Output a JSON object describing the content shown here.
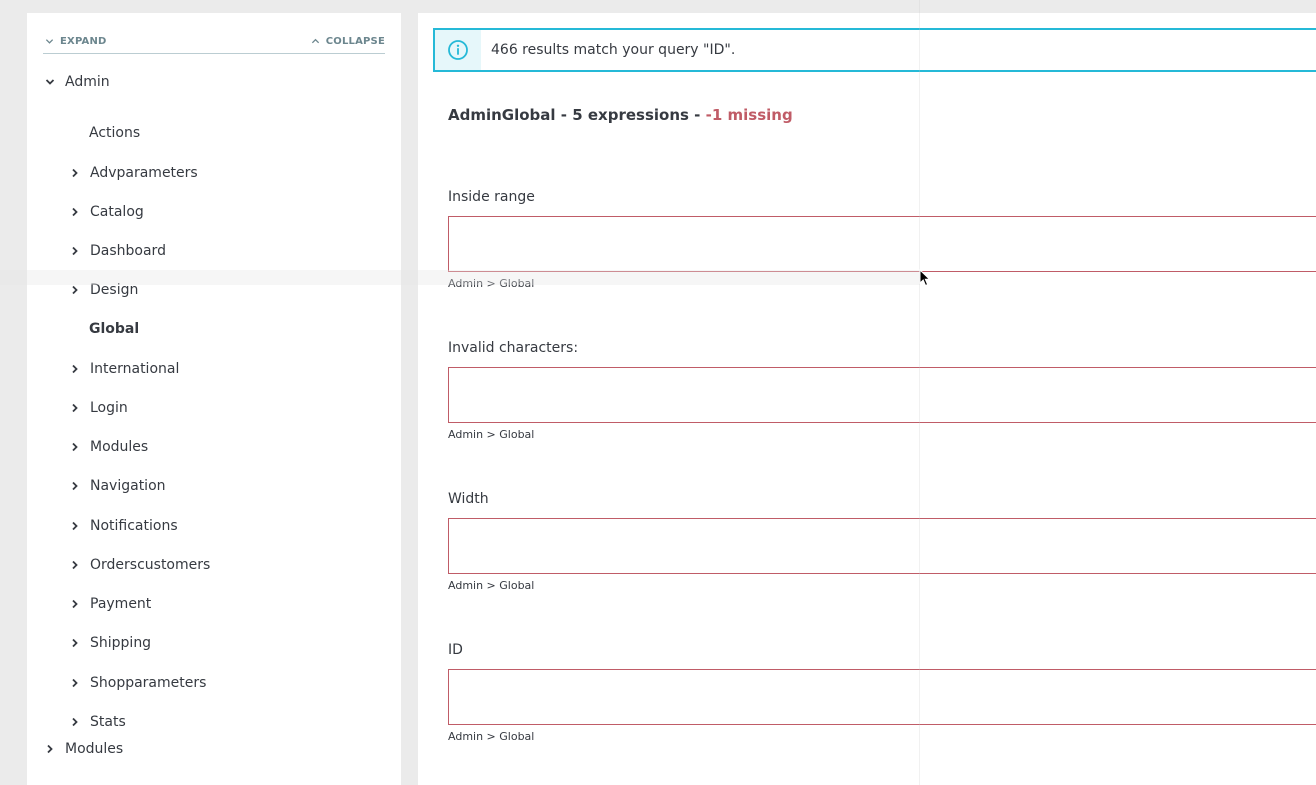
{
  "tree": {
    "expand_label": "EXPAND",
    "collapse_label": "COLLAPSE",
    "root": {
      "label": "Admin",
      "expanded": true
    },
    "children": [
      {
        "label": "Actions",
        "has_children": false,
        "active": false
      },
      {
        "label": "Advparameters",
        "has_children": true,
        "active": false
      },
      {
        "label": "Catalog",
        "has_children": true,
        "active": false
      },
      {
        "label": "Dashboard",
        "has_children": true,
        "active": false
      },
      {
        "label": "Design",
        "has_children": true,
        "active": false
      },
      {
        "label": "Global",
        "has_children": false,
        "active": true
      },
      {
        "label": "International",
        "has_children": true,
        "active": false
      },
      {
        "label": "Login",
        "has_children": true,
        "active": false
      },
      {
        "label": "Modules",
        "has_children": true,
        "active": false
      },
      {
        "label": "Navigation",
        "has_children": true,
        "active": false
      },
      {
        "label": "Notifications",
        "has_children": true,
        "active": false
      },
      {
        "label": "Orderscustomers",
        "has_children": true,
        "active": false
      },
      {
        "label": "Payment",
        "has_children": true,
        "active": false
      },
      {
        "label": "Shipping",
        "has_children": true,
        "active": false
      },
      {
        "label": "Shopparameters",
        "has_children": true,
        "active": false
      },
      {
        "label": "Stats",
        "has_children": true,
        "active": false
      }
    ],
    "sibling": {
      "label": "Modules",
      "expanded": false
    }
  },
  "alert": {
    "text": "466 results match your query \"ID\".",
    "icon": "info-icon",
    "color": "#25b9d7"
  },
  "domain": {
    "title": "AdminGlobal - 5 expressions - ",
    "missing": "-1 missing",
    "missing_color": "#c05c67"
  },
  "fields": [
    {
      "label": "Inside range",
      "value": "",
      "hint": "Admin > Global"
    },
    {
      "label": "Invalid characters:",
      "value": "",
      "hint": "Admin > Global"
    },
    {
      "label": "Width",
      "value": "",
      "hint": "Admin > Global"
    },
    {
      "label": "ID",
      "value": "",
      "hint": "Admin > Global"
    }
  ]
}
